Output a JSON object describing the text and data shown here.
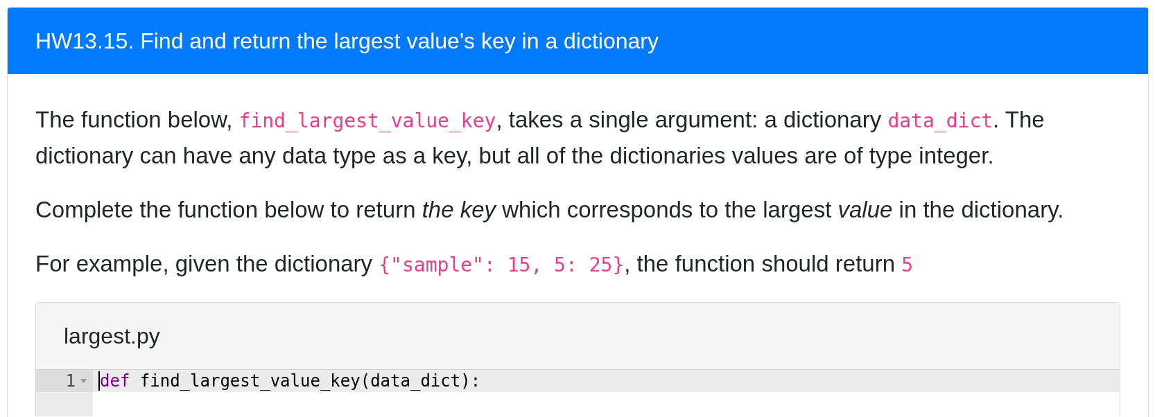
{
  "problem": {
    "title": "HW13.15. Find and return the largest value's key in a dictionary"
  },
  "description": [
    {
      "segments": [
        {
          "kind": "text",
          "text": "The function below, "
        },
        {
          "kind": "code",
          "text": "find_largest_value_key"
        },
        {
          "kind": "text",
          "text": ", takes a single argument: a dictionary "
        },
        {
          "kind": "code",
          "text": "data_dict"
        },
        {
          "kind": "text",
          "text": ". The dictionary can have any data type as a key, but all of the dictionaries values are of type integer."
        }
      ]
    },
    {
      "segments": [
        {
          "kind": "text",
          "text": "Complete the function below to return *the key* which corresponds to the largest *value* in the dictionary."
        }
      ]
    },
    {
      "segments": [
        {
          "kind": "text",
          "text": "For example, given the dictionary "
        },
        {
          "kind": "code",
          "text": "{\"sample\": 15, 5: 25}"
        },
        {
          "kind": "text",
          "text": ", the function should return "
        },
        {
          "kind": "code",
          "text": "5"
        }
      ]
    }
  ],
  "editor": {
    "file_name": "largest.py",
    "lines": [
      {
        "number": "1",
        "active": true,
        "foldable": true,
        "tokens": [
          {
            "kind": "keyword",
            "text": "def"
          },
          {
            "kind": "plain",
            "text": " find_largest_value_key(data_dict):"
          }
        ]
      }
    ]
  }
}
